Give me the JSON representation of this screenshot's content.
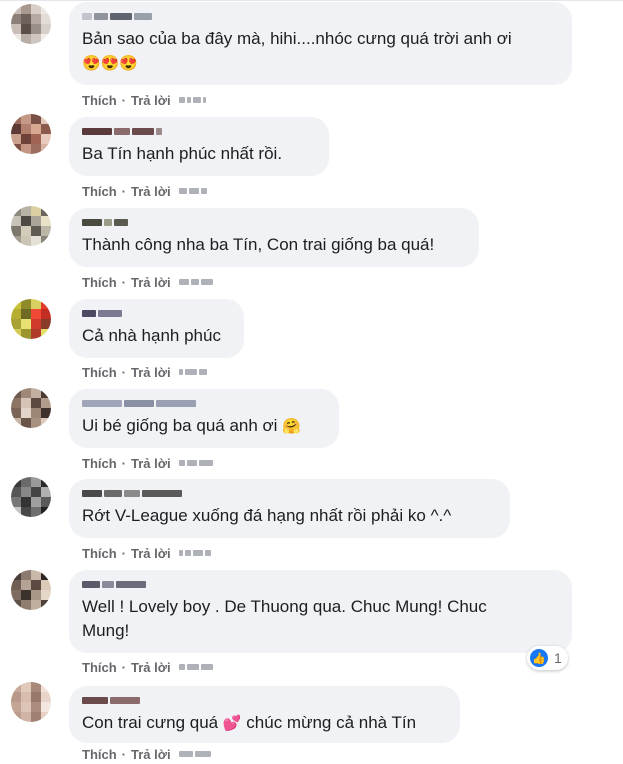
{
  "actions": {
    "like": "Thích",
    "reply": "Trả lời",
    "separator": "·"
  },
  "comments": [
    {
      "text": "Bản sao của ba đây mà, hihi....nhóc cưng quá trời anh ơi",
      "emoji": "😍😍😍",
      "avatar_colors": [
        "#c8c0b8",
        "#a89890",
        "#d8d0c8",
        "#ece8e4",
        "#8c7f78",
        "#6f625d",
        "#b5a9a2",
        "#e2dcd7",
        "#c9bfb8",
        "#5c4f4a",
        "#9a8e88",
        "#d6cfc9",
        "#eee9e5",
        "#b8aea8",
        "#cfc6c0",
        "#f2eeea"
      ]
    },
    {
      "text": "Ba Tín hạnh phúc nhất rồi.",
      "emoji": "",
      "avatar_colors": [
        "#9c6b5e",
        "#c49a86",
        "#7a4f45",
        "#e3c7b8",
        "#5d3a35",
        "#b07f6e",
        "#d8a891",
        "#8b5a4c",
        "#caa08e",
        "#6e4238",
        "#a06454",
        "#e9cbbd",
        "#7f5045",
        "#c29683",
        "#9d6e60",
        "#d9b3a2"
      ]
    },
    {
      "text": "Thành công nha ba Tín, Con trai giống ba quá!",
      "emoji": "",
      "avatar_colors": [
        "#8f8a80",
        "#b8b2a6",
        "#d9cfa0",
        "#6a665e",
        "#c8c3b8",
        "#4d4a44",
        "#a9a497",
        "#e8e2c8",
        "#7d786e",
        "#d3ccba",
        "#5f5b53",
        "#bdb7aa",
        "#a39e92",
        "#cbc5b5",
        "#e6e1d6",
        "#8a8579"
      ]
    },
    {
      "text": "Cả nhà hạnh phúc",
      "emoji": "",
      "avatar_colors": [
        "#c9c23a",
        "#8f8a2a",
        "#d8d060",
        "#e33b2b",
        "#b5ae30",
        "#6f6a22",
        "#f04a36",
        "#c42e22",
        "#a8a235",
        "#e8e070",
        "#cf3a2e",
        "#8a3a28",
        "#d4cd55",
        "#9b962e",
        "#b03a2a",
        "#e5dd6a"
      ]
    },
    {
      "text": "Ui bé giống ba quá anh ơi",
      "emoji": "🤗",
      "avatar_colors": [
        "#6e5a4e",
        "#a08878",
        "#c4b0a0",
        "#4a3a32",
        "#8d7566",
        "#d6c4b6",
        "#5c4a40",
        "#b39c8c",
        "#7a6456",
        "#e2d4c8",
        "#9e8676",
        "#3e302a",
        "#c9b5a6",
        "#6a5648",
        "#a8907f",
        "#dccbbd"
      ]
    },
    {
      "text": "Rớt V-League xuống đá hạng nhất rồi phải ko ^.^",
      "emoji": "",
      "avatar_colors": [
        "#3a3a3a",
        "#6a6a6a",
        "#9a9a9a",
        "#2a2a2a",
        "#555555",
        "#888888",
        "#444444",
        "#b0b0b0",
        "#777777",
        "#333333",
        "#a0a0a0",
        "#5a5a5a",
        "#c4c4c4",
        "#484848",
        "#6e6e6e",
        "#222222"
      ]
    },
    {
      "text": "Well ! Lovely boy . De Thuong qua. Chuc Mung! Chuc\nMung!",
      "emoji": "",
      "reaction_count": "1",
      "avatar_colors": [
        "#4a3e38",
        "#8a7a70",
        "#c8b8aa",
        "#2e2622",
        "#6e5e54",
        "#b4a294",
        "#5a4a42",
        "#dccab8",
        "#7e6c60",
        "#3c322c",
        "#a89686",
        "#e4d6c8",
        "#605048",
        "#907e70",
        "#c0ae9e",
        "#4e423a"
      ]
    },
    {
      "text": "Con trai cưng quá",
      "emoji": "💕",
      "text_after": "chúc mừng cả nhà Tín",
      "avatar_colors": [
        "#c8a898",
        "#e0c8ba",
        "#a88878",
        "#f0e0d6",
        "#b89888",
        "#d8bcae",
        "#987868",
        "#e8d4c8",
        "#c4a494",
        "#dcc4b6",
        "#ac8c7c",
        "#f2e6de",
        "#bc9c8c",
        "#d0b4a6",
        "#a08070",
        "#e6d0c4"
      ]
    }
  ]
}
